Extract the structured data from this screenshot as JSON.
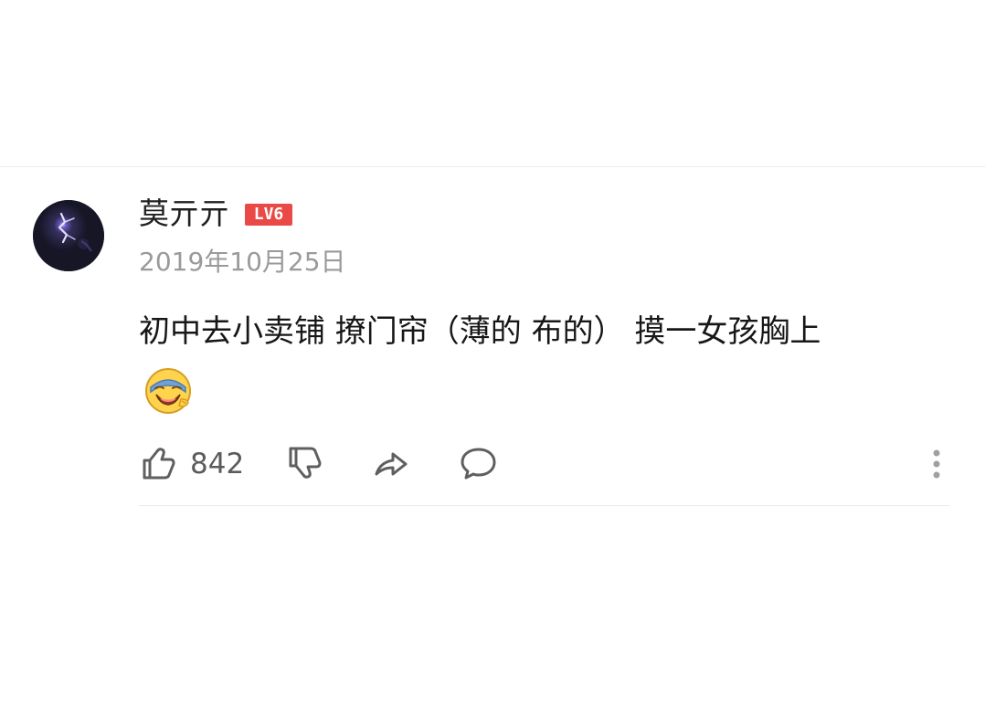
{
  "comment": {
    "username": "莫亓亓",
    "level_badge": "LV6",
    "date": "2019年10月25日",
    "text": "初中去小卖铺  撩门帘（薄的 布的） 摸一女孩胸上",
    "emoji": "laughing-face-emoji",
    "like_count": "842"
  },
  "icons": {
    "like": "thumbs-up-icon",
    "dislike": "thumbs-down-icon",
    "share": "share-icon",
    "comment": "comment-icon",
    "more": "more-vertical-icon"
  },
  "colors": {
    "badge": "#ea4a45",
    "date_text": "#9a9a9a",
    "icon_gray": "#5f5f5f",
    "divider": "#ececec"
  }
}
